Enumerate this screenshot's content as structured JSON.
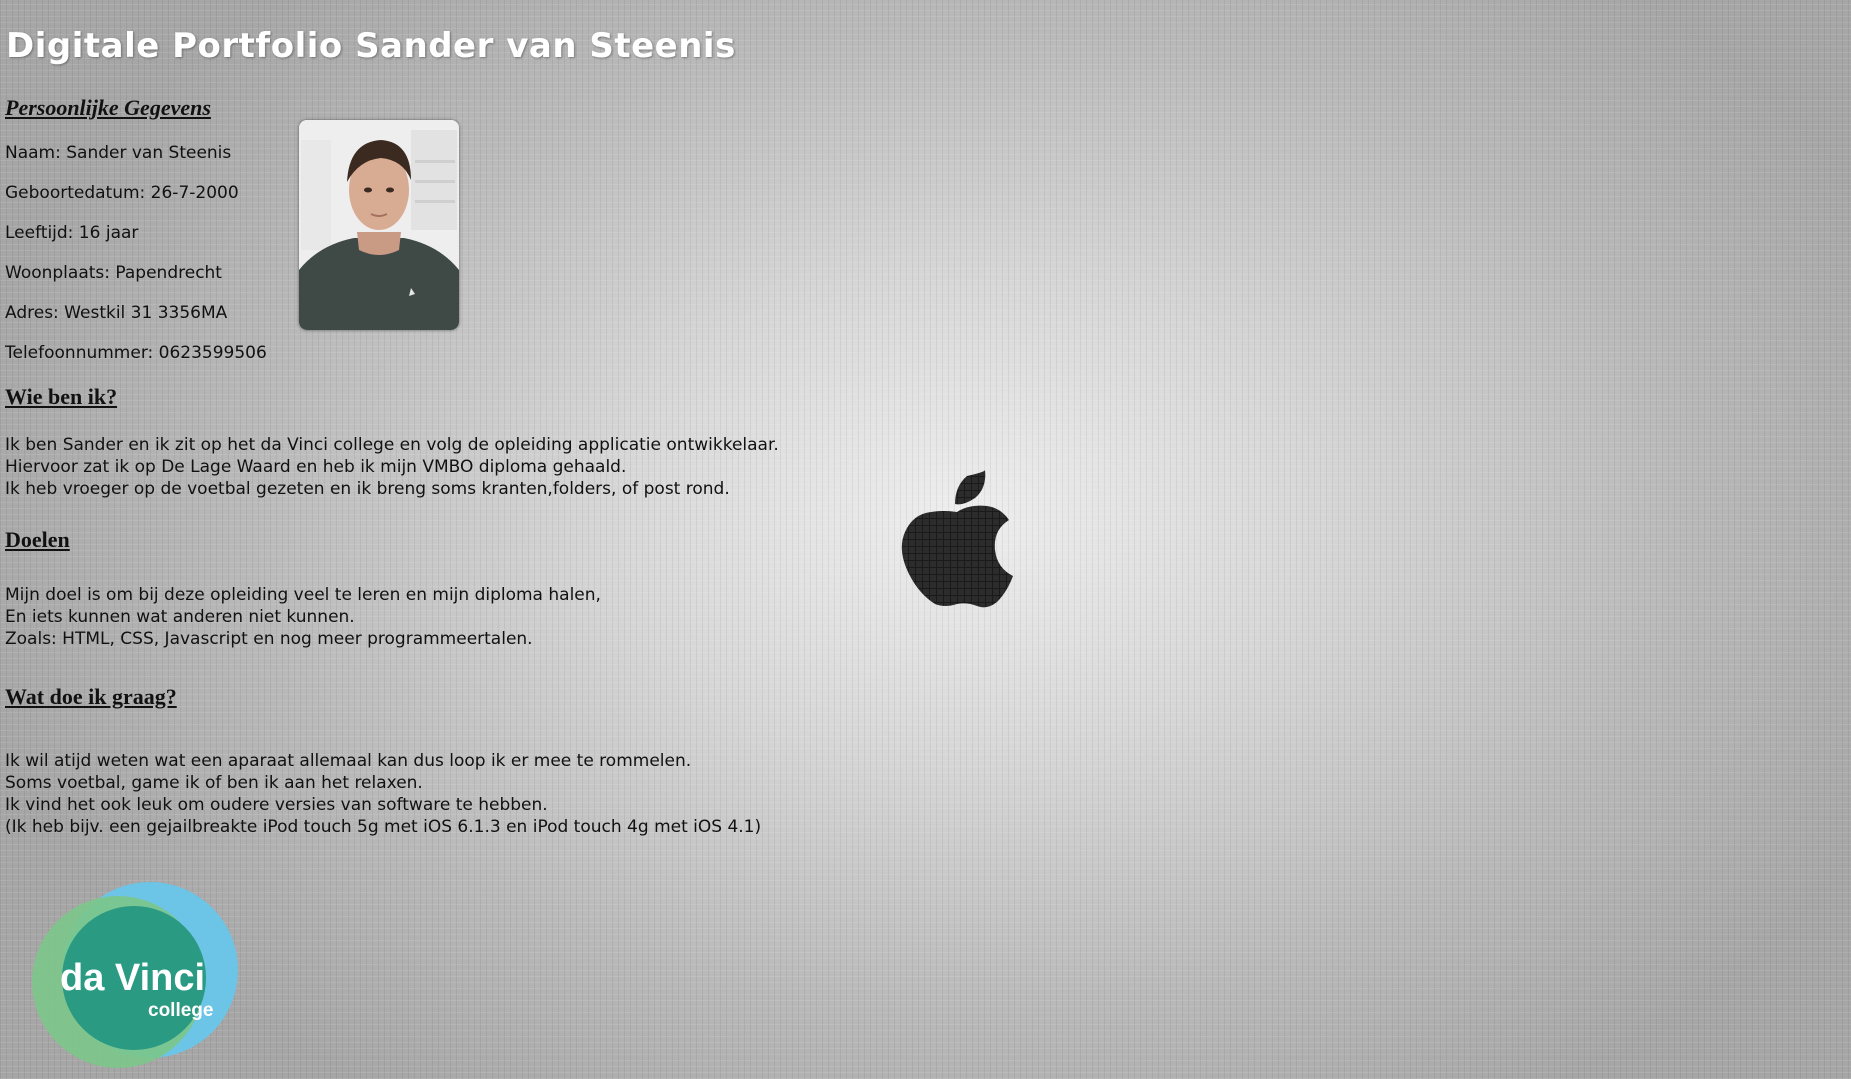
{
  "header": {
    "title": "Digitale Portfolio Sander van Steenis"
  },
  "personal": {
    "heading": "Persoonlijke Gegevens",
    "lines": [
      "Naam: Sander van Steenis",
      "Geboortedatum: 26-7-2000",
      "Leeftijd: 16 jaar",
      "Woonplaats: Papendrecht",
      "Adres: Westkil 31 3356MA",
      "Telefoonnummer: 0623599506"
    ]
  },
  "about": {
    "heading": "Wie ben ik?",
    "lines": [
      "Ik ben Sander en ik zit op het da Vinci college en volg de opleiding applicatie ontwikkelaar.",
      "Hiervoor zat ik op De Lage Waard en heb ik mijn VMBO diploma gehaald.",
      "Ik heb vroeger op de voetbal gezeten en ik breng soms kranten,folders, of post rond."
    ]
  },
  "goals": {
    "heading": "Doelen",
    "lines": [
      "Mijn doel is om bij deze opleiding veel te leren en mijn diploma halen,",
      "En iets kunnen wat anderen niet kunnen.",
      "Zoals: HTML, CSS, Javascript en nog meer programmeertalen."
    ]
  },
  "hobbies": {
    "heading": "Wat doe ik graag?",
    "lines": [
      "Ik wil atijd weten wat een aparaat allemaal kan dus loop ik er mee te rommelen.",
      "Soms voetbal, game ik of ben ik aan het relaxen.",
      "Ik vind het ook leuk om oudere versies van software te hebben.",
      "(Ik heb bijv. een gejailbreakte iPod touch 5g met iOS 6.1.3 en iPod touch 4g met iOS 4.1)"
    ]
  },
  "logo": {
    "line1": "da Vinci",
    "line2": "college"
  },
  "colors": {
    "title": "#ffffff",
    "text": "#111111",
    "logo_outer": "#6cc4e6",
    "logo_inner": "#2a9a82",
    "logo_green": "#7cc78a"
  },
  "icons": {
    "center": "apple-logo-icon",
    "bottom_left": "davinci-college-logo"
  }
}
